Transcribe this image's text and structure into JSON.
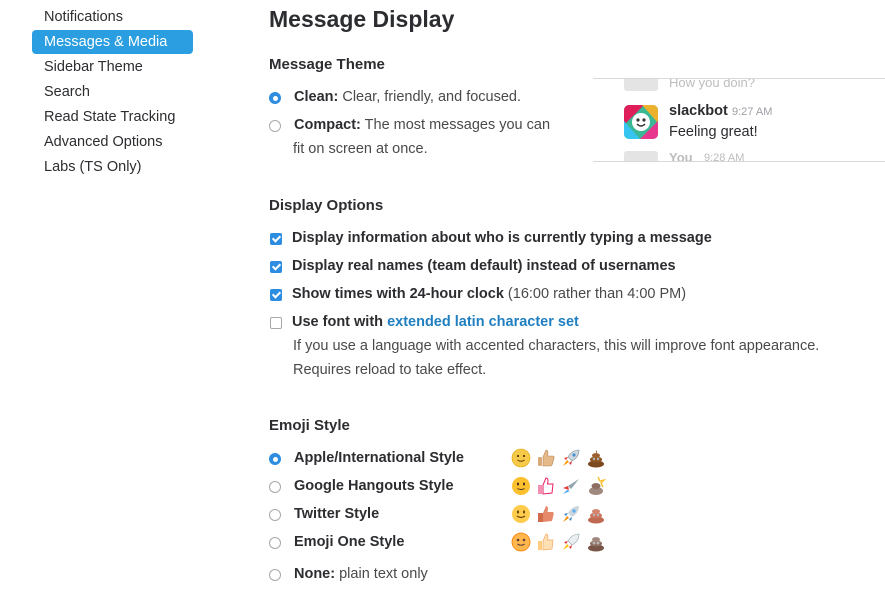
{
  "sidebar": {
    "items": [
      {
        "label": "Notifications"
      },
      {
        "label": "Messages & Media"
      },
      {
        "label": "Sidebar Theme"
      },
      {
        "label": "Search"
      },
      {
        "label": "Read State Tracking"
      },
      {
        "label": "Advanced Options"
      },
      {
        "label": "Labs (TS Only)"
      }
    ],
    "active_index": 1
  },
  "page_title": "Message Display",
  "message_theme": {
    "title": "Message Theme",
    "clean": {
      "label": "Clean:",
      "desc": " Clear, friendly, and focused.",
      "selected": true
    },
    "compact": {
      "label": "Compact:",
      "desc_line1": " The most messages you can",
      "desc_line2": "fit on screen at once.",
      "selected": false
    }
  },
  "preview": {
    "ghost_top": "How you doin?",
    "bot_name": "slackbot",
    "bot_time": "9:27 AM",
    "bot_message": "Feeling great!",
    "ghost_bottom": "You",
    "ghost_bottom_time": "9:28 AM"
  },
  "display_options": {
    "title": "Display Options",
    "typing": {
      "label": "Display information about who is currently typing a message",
      "checked": true
    },
    "real_names": {
      "label": "Display real names (team default) instead of usernames",
      "checked": true
    },
    "clock": {
      "label": "Show times with 24-hour clock",
      "hint": " (16:00 rather than 4:00 PM)",
      "checked": true
    },
    "latin": {
      "label": "Use font with ",
      "link": "extended latin character set",
      "help_line1": "If you use a language with accented characters, this will improve font appearance.",
      "help_line2": "Requires reload to take effect.",
      "checked": false
    }
  },
  "emoji_style": {
    "title": "Emoji Style",
    "options": [
      {
        "label": "Apple/International Style",
        "selected": true,
        "icons": [
          "slightly-smiling-face-icon",
          "thumbs-up-icon",
          "rocket-icon",
          "poop-icon"
        ]
      },
      {
        "label": "Google Hangouts Style",
        "selected": false,
        "icons": [
          "slightly-smiling-face-icon",
          "thumbs-up-icon",
          "rocket-icon",
          "poop-icon"
        ]
      },
      {
        "label": "Twitter Style",
        "selected": false,
        "icons": [
          "slightly-smiling-face-icon",
          "thumbs-up-icon",
          "rocket-icon",
          "poop-icon"
        ]
      },
      {
        "label": "Emoji One Style",
        "selected": false,
        "icons": [
          "slightly-smiling-face-icon",
          "thumbs-up-icon",
          "rocket-icon",
          "poop-icon"
        ]
      }
    ],
    "none": {
      "label": "None:",
      "desc": " plain text only",
      "selected": false
    }
  },
  "colors": {
    "accent": "#2d8de0",
    "active_nav": "#2a9ee0",
    "link": "#1f7fc1"
  }
}
